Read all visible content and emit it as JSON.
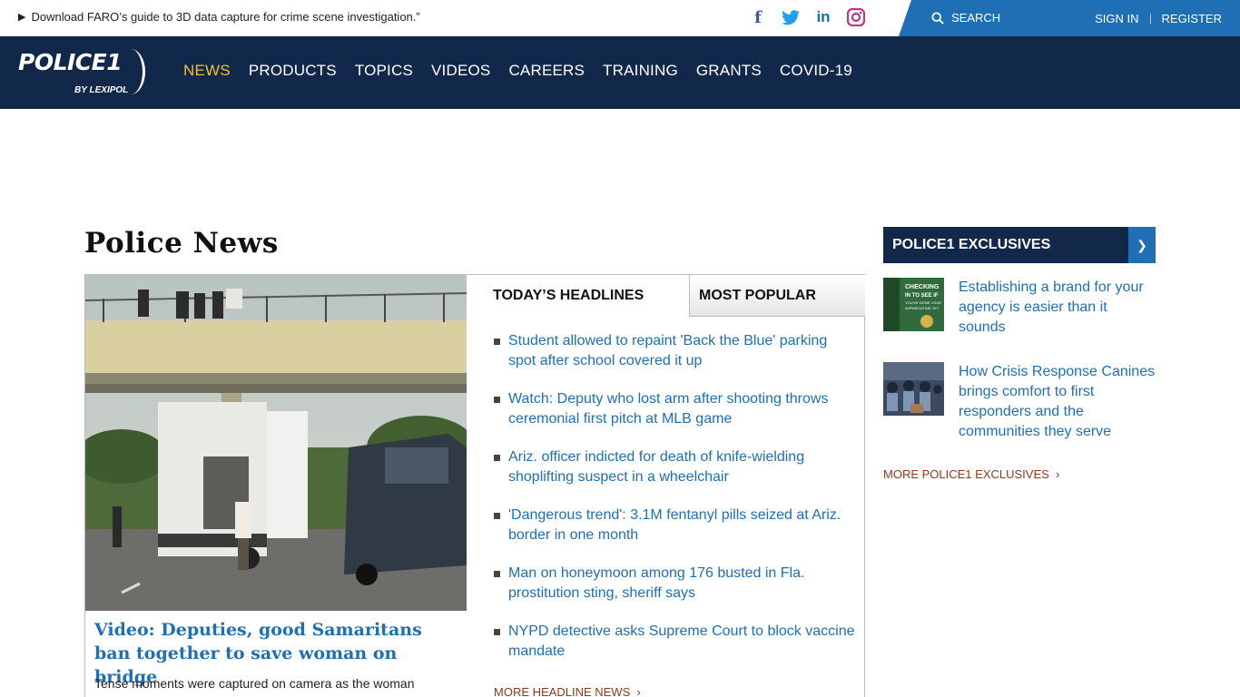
{
  "topbar": {
    "promo_text": "Download FARO’s guide to 3D data capture for crime scene investigation.”",
    "social": [
      "facebook-icon",
      "twitter-icon",
      "linkedin-icon",
      "instagram-icon"
    ],
    "search_label": "SEARCH",
    "sign_in": "SIGN IN",
    "register": "REGISTER"
  },
  "nav": {
    "logo_word": "POLICE1",
    "logo_by": "BY LEXIPOL",
    "items": [
      "NEWS",
      "PRODUCTS",
      "TOPICS",
      "VIDEOS",
      "CAREERS",
      "TRAINING",
      "GRANTS",
      "COVID-19"
    ],
    "active": "NEWS"
  },
  "main": {
    "page_title": "Police News",
    "hero": {
      "title": "Video: Deputies, good Samaritans ban together to save woman on bridge",
      "description": "Tense moments were captured on camera as the woman threatened to jump off the..."
    },
    "tabs": [
      "TODAY’S HEADLINES",
      "MOST POPULAR"
    ],
    "headlines": [
      "Student allowed to repaint 'Back the Blue' parking spot after school covered it up",
      "Watch: Deputy who lost arm after shooting throws ceremonial first pitch at MLB game",
      "Ariz. officer indicted for death of knife-wielding shoplifting suspect in a wheelchair",
      "'Dangerous trend': 3.1M fentanyl pills seized at Ariz. border in one month",
      "Man on honeymoon among 176 busted in Fla. prostitution sting, sheriff says",
      "NYPD detective asks Supreme Court to block vaccine mandate"
    ],
    "more_headlines": "MORE HEADLINE NEWS"
  },
  "sidebar": {
    "title": "POLICE1 EXCLUSIVES",
    "items": [
      {
        "title": "Establishing a brand for your agency is easier than it sounds",
        "thumb_text": "CHECKING IN TO SEE IF YOU'VE DONE YOUR #9PMROUTINE YET"
      },
      {
        "title": "How Crisis Response Canines brings comfort to first responders and the communities they serve"
      }
    ],
    "more": "MORE POLICE1 EXCLUSIVES"
  },
  "colors": {
    "navy": "#12284b",
    "blue": "#1e6fb4",
    "active_nav": "#f2c12e",
    "more_link": "#8a3a1a"
  }
}
